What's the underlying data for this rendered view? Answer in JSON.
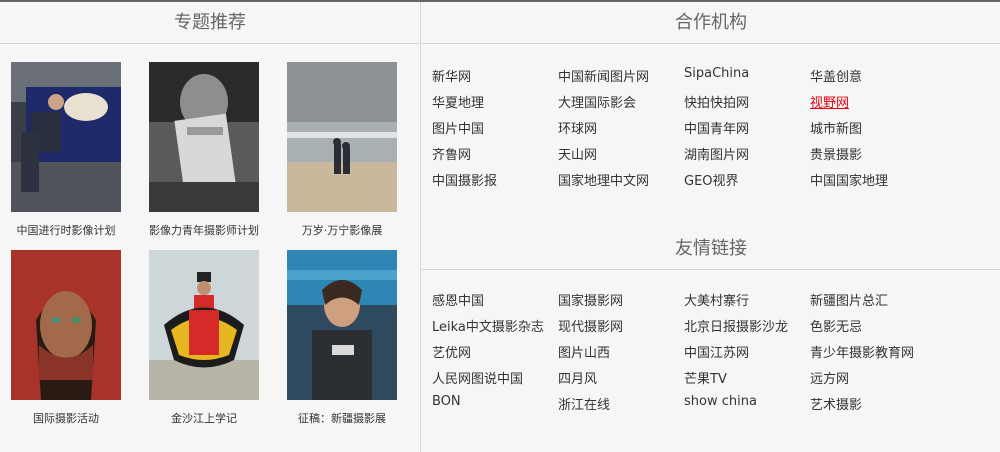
{
  "featured": {
    "title": "专题推荐",
    "items": [
      {
        "caption": "中国进行时影像计划"
      },
      {
        "caption": "影像力青年摄影师计划"
      },
      {
        "caption": "万岁·万宁影像展"
      },
      {
        "caption": "国际摄影活动"
      },
      {
        "caption": "金沙江上学记"
      },
      {
        "caption": "征稿：新疆摄影展"
      }
    ]
  },
  "partners": {
    "title": "合作机构",
    "rows": [
      [
        "新华网",
        "中国新闻图片网",
        "SipaChina",
        "华盖创意"
      ],
      [
        "华夏地理",
        "大理国际影会",
        "快拍快拍网",
        "视野网"
      ],
      [
        "图片中国",
        "环球网",
        "中国青年网",
        "城市新图"
      ],
      [
        "齐鲁网",
        "天山网",
        "湖南图片网",
        "贵景摄影"
      ],
      [
        "中国摄影报",
        "国家地理中文网",
        "GEO视界",
        "中国国家地理"
      ]
    ],
    "highlighted": "视野网"
  },
  "friends": {
    "title": "友情链接",
    "rows": [
      [
        "感恩中国",
        "国家摄影网",
        "大美村寨行",
        "新疆图片总汇"
      ],
      [
        "Leika中文摄影杂志",
        "现代摄影网",
        "北京日报摄影沙龙",
        "色影无忌"
      ],
      [
        "艺优网",
        "图片山西",
        "中国江苏网",
        "青少年摄影教育网"
      ],
      [
        "人民网图说中国",
        "四月风",
        "芒果TV",
        "远方网"
      ],
      [
        "BON",
        "浙江在线",
        "show china",
        "艺术摄影"
      ]
    ]
  },
  "colors": {
    "link": "#333333",
    "link_highlight": "#e60012",
    "title": "#666666",
    "divider": "#d6d6d6",
    "background": "#f6f6f6"
  }
}
